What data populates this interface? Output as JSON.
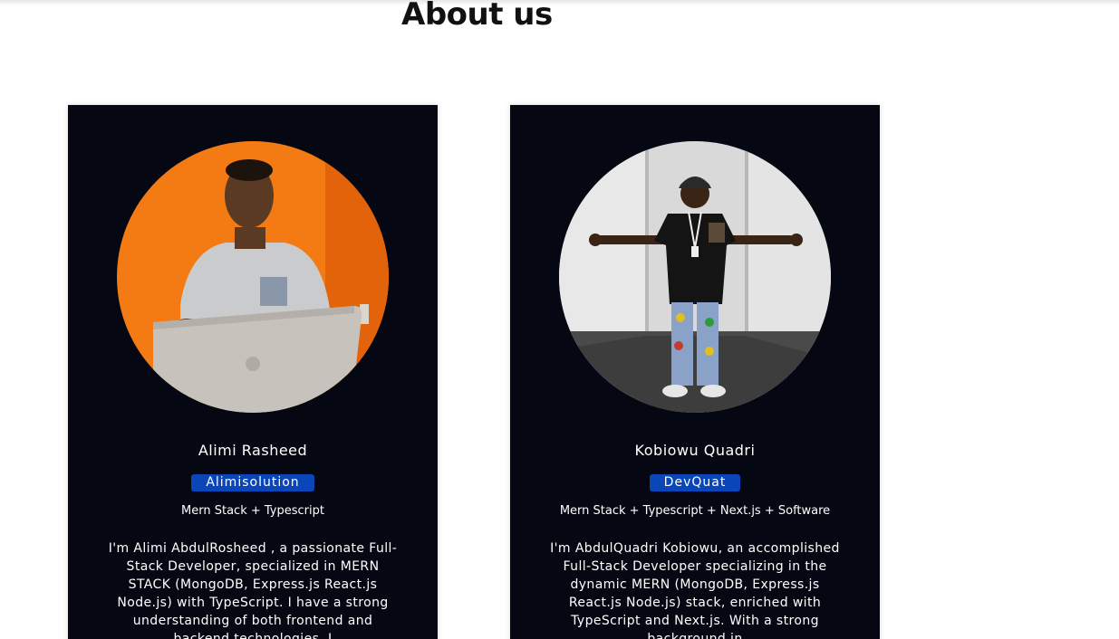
{
  "page": {
    "title": "About us"
  },
  "members": [
    {
      "name": "Alimi Rasheed",
      "badge": "Alimisolution",
      "stack": "Mern Stack + Typescript",
      "bio": "I'm Alimi AbdulRosheed , a passionate Full-Stack Developer, specialized in MERN STACK (MongoDB, Express.js React.js Node.js) with TypeScript. I have a strong understanding of both frontend and backend technologies. I"
    },
    {
      "name": "Kobiowu Quadri",
      "badge": "DevQuat",
      "stack": "Mern Stack + Typescript + Next.js + Software",
      "bio": "I'm AbdulQuadri Kobiowu, an accomplished Full-Stack Developer specializing in the dynamic MERN (MongoDB, Express.js React.js Node.js) stack, enriched with TypeScript and Next.js. With a strong background in"
    }
  ],
  "colors": {
    "card_background": "#050812",
    "badge_background": "#0a46b8",
    "photo1_background": "#f47a14",
    "photo2_background": "#d9d9d9"
  }
}
